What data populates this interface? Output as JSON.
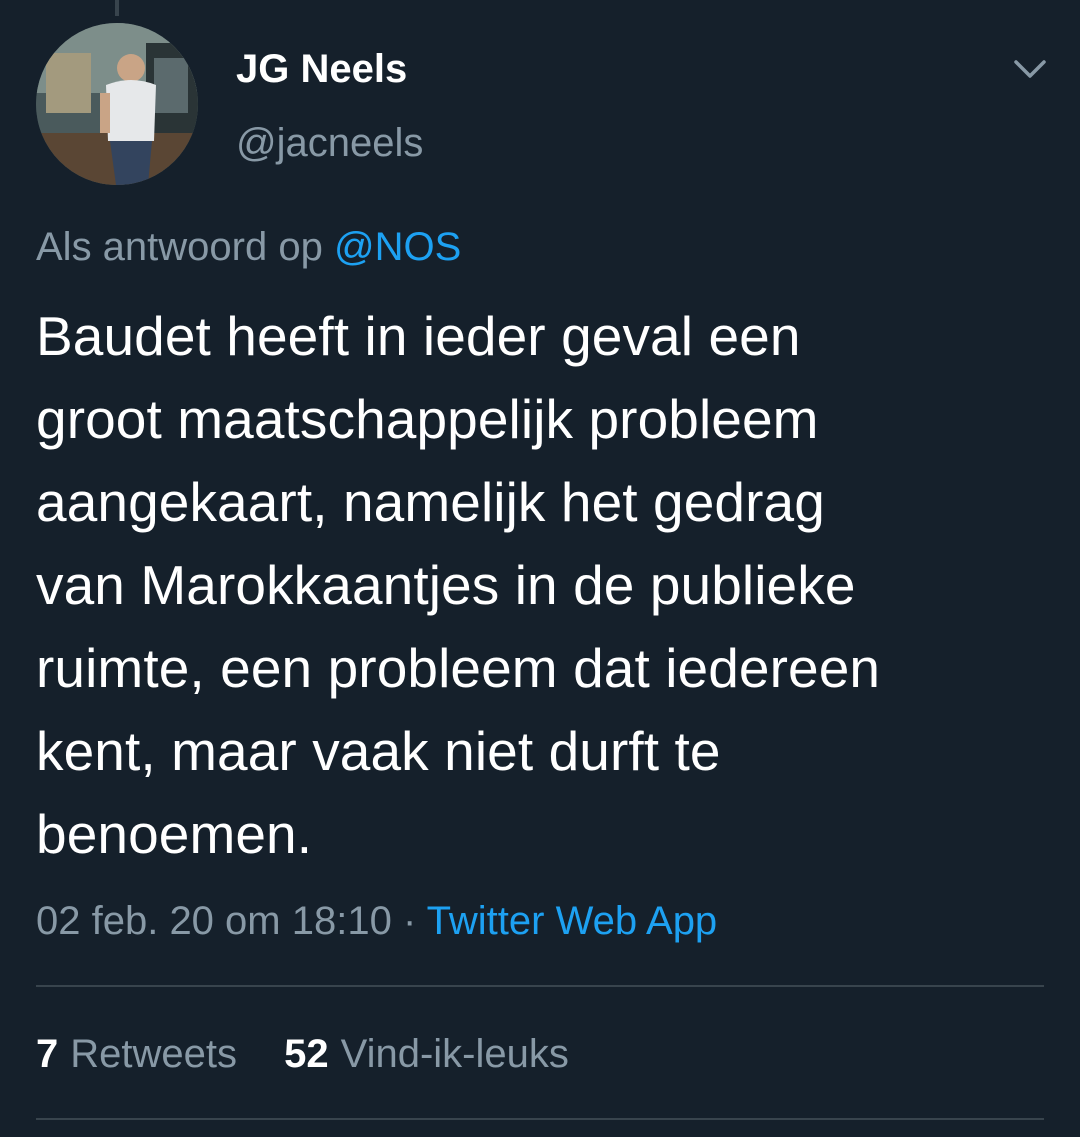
{
  "tweet": {
    "author": {
      "name": "JG Neels",
      "handle": "@jacneels"
    },
    "reply_prefix": "Als antwoord op",
    "reply_mention": "@NOS",
    "text_lines": [
      "Baudet heeft in ieder geval een",
      "groot maatschappelijk probleem",
      "aangekaart, namelijk het gedrag",
      "van Marokkaantjes in de publieke",
      "ruimte, een probleem dat iedereen",
      "kent, maar vaak niet durft te",
      "benoemen."
    ],
    "timestamp": "02 feb. 20 om 18:10",
    "separator": "·",
    "source": "Twitter Web App",
    "stats": {
      "retweets_count": "7",
      "retweets_label": "Retweets",
      "likes_count": "52",
      "likes_label": "Vind-ik-leuks"
    }
  },
  "icons": {
    "menu": "chevron-down-icon"
  },
  "colors": {
    "background": "#15202b",
    "secondary_text": "#8899a6",
    "accent": "#1da1f2",
    "divider": "#38444d"
  }
}
